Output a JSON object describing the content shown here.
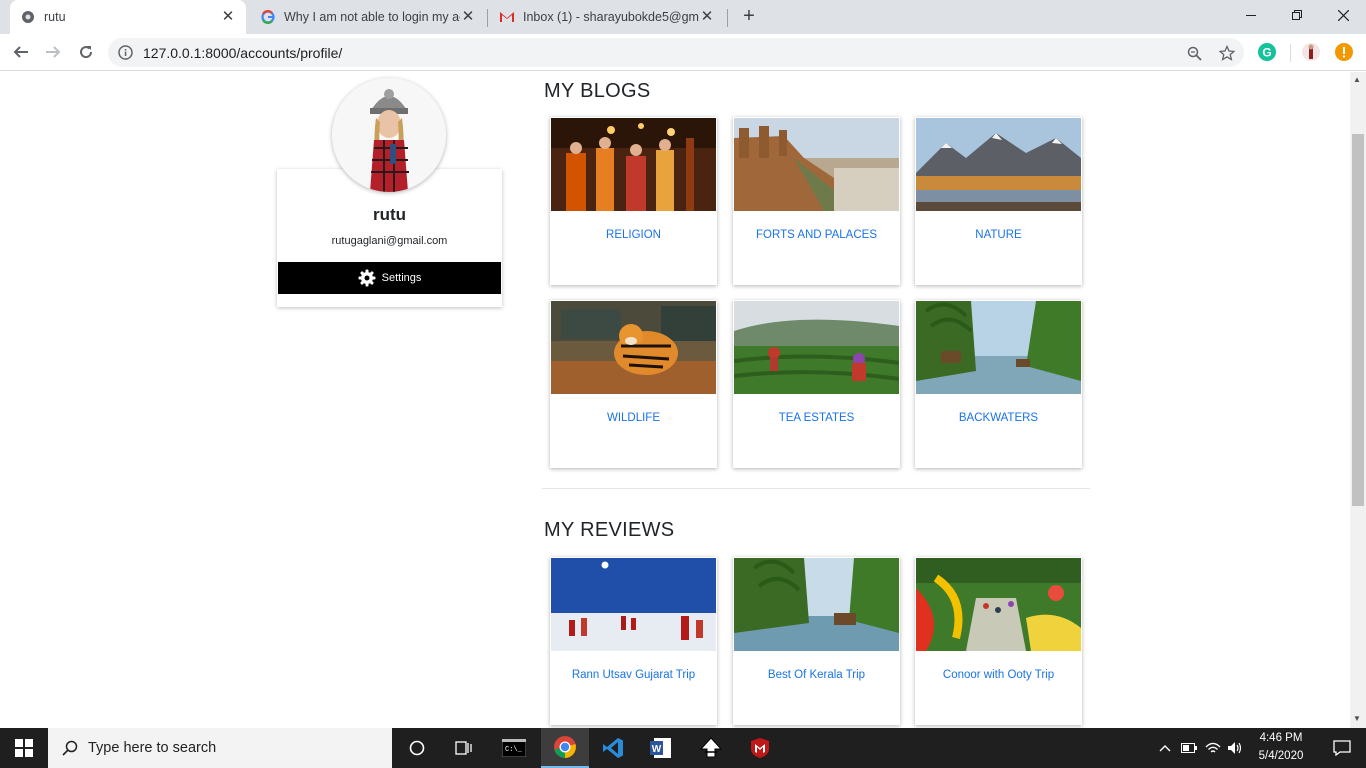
{
  "browser": {
    "tabs": [
      {
        "title": "rutu",
        "active": true
      },
      {
        "title": "Why I am not able to login my ac",
        "active": false
      },
      {
        "title": "Inbox (1) - sharayubokde5@gma",
        "active": false
      }
    ],
    "address": "127.0.0.1:8000/accounts/profile/"
  },
  "profile": {
    "name": "rutu",
    "email": "rutugaglani@gmail.com",
    "settings_label": "Settings"
  },
  "blogs": {
    "title": "MY BLOGS",
    "items": [
      {
        "label": "RELIGION"
      },
      {
        "label": "FORTS AND PALACES"
      },
      {
        "label": "NATURE"
      },
      {
        "label": "WILDLIFE"
      },
      {
        "label": "TEA ESTATES"
      },
      {
        "label": "BACKWATERS"
      }
    ]
  },
  "reviews": {
    "title": "MY REVIEWS",
    "items": [
      {
        "label": "Rann Utsav Gujarat Trip"
      },
      {
        "label": "Best Of Kerala Trip"
      },
      {
        "label": "Conoor with Ooty Trip"
      }
    ]
  },
  "taskbar": {
    "search_placeholder": "Type here to search",
    "time": "4:46 PM",
    "date": "5/4/2020"
  },
  "colors": {
    "link": "#1a73e8",
    "settings_bg": "#000000"
  }
}
